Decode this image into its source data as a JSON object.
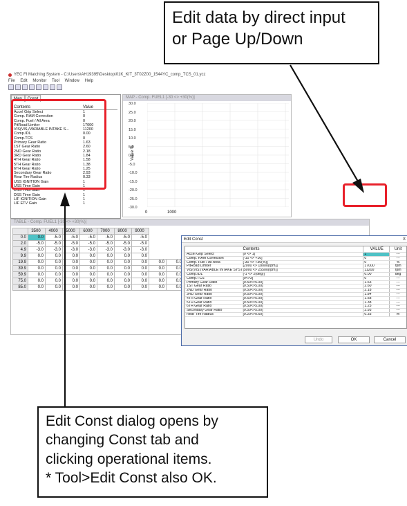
{
  "callouts": {
    "top": "Edit data by direct input\nor Page Up/Down",
    "bottom": "Edit Const dialog opens by\nchanging Const tab and\nclicking operational items.\n* Tool>Edit Const also OK."
  },
  "window": {
    "title": "YEC FI Matching System - C:\\Users\\AH19395\\Desktop\\01K_KIT_3T02Z00_1544YC_comp_TCS_01.ycz",
    "menu": [
      "File",
      "Edit",
      "Monitor",
      "Tool",
      "Window",
      "Help"
    ]
  },
  "left_panel": {
    "tabs": [
      "Map",
      "Const"
    ],
    "columns": [
      "Contents",
      "Value"
    ],
    "rows": [
      [
        "Accel Grip Select",
        "1"
      ],
      [
        "Comp. RAM Correction",
        "0"
      ],
      [
        "Comp. Fuel / All Area",
        "0"
      ],
      [
        "PitRoad Limiter",
        "17000"
      ],
      [
        "VIS(VIS,/VARIABLE INTAKE S...",
        "11200"
      ],
      [
        "Comp.IDL",
        "0.00"
      ],
      [
        "Comp.TCS",
        "0"
      ],
      [
        "Primary Gear Ratio",
        "1.63"
      ],
      [
        "1ST Gear Ratio",
        "2.60"
      ],
      [
        "2ND Gear Ratio",
        "2.18"
      ],
      [
        "3RD Gear Ratio",
        "1.84"
      ],
      [
        "4TH Gear Ratio",
        "1.58"
      ],
      [
        "5TH Gear Ratio",
        "1.38"
      ],
      [
        "6TH Gear Ratio",
        "1.25"
      ],
      [
        "Secondary Gear Ratio",
        "2.93"
      ],
      [
        "Rear Tire Radius",
        "0.33"
      ],
      [
        "USS IGNITION Gain",
        "1"
      ],
      [
        "USS Time Gain",
        "1"
      ],
      [
        "DSS THG Gain",
        "1"
      ],
      [
        "DSS Time Gain",
        "1"
      ],
      [
        "LIF IGNITION Gain",
        "1"
      ],
      [
        "LIF ETV Gain",
        "1"
      ]
    ]
  },
  "graph": {
    "header": "MAP - Comp. FUEL1      [-30 <> +30(%)]",
    "yticks": [
      "30.0",
      "25.0",
      "20.0",
      "15.0",
      "10.0",
      "5.0",
      "0.0",
      "-5.0",
      "-10.0",
      "-15.0",
      "-20.0",
      "-25.0",
      "-30.0"
    ],
    "xticks": [
      "0",
      "1000"
    ],
    "ylabel": "Value %"
  },
  "table": {
    "header": "TABLE - Comp. FUEL1      [-30 <> +30(%)]",
    "columns": [
      "3500",
      "4000",
      "5000",
      "6000",
      "7000",
      "8000",
      "9000"
    ],
    "rows": [
      {
        "h": "0.0",
        "v": [
          "0.0",
          "-5.0",
          "-5.0",
          "-5.0",
          "-5.0",
          "-5.0",
          "-5.0"
        ]
      },
      {
        "h": "2.0",
        "v": [
          "-5.0",
          "-5.0",
          "-5.0",
          "-5.0",
          "-5.0",
          "-5.0",
          "-5.0"
        ]
      },
      {
        "h": "4.9",
        "v": [
          "-3.0",
          "-3.0",
          "-3.0",
          "-3.0",
          "-3.0",
          "-3.0",
          "-3.0"
        ]
      },
      {
        "h": "9.9",
        "v": [
          "0.0",
          "0.0",
          "0.0",
          "0.0",
          "0.0",
          "0.0",
          "0.0"
        ]
      },
      {
        "h": "19.9",
        "v": [
          "0.0",
          "0.0",
          "0.0",
          "0.0",
          "0.0",
          "0.0",
          "0.0",
          "0.0",
          "0.0",
          "0.0",
          "0.0",
          "0.0"
        ]
      },
      {
        "h": "39.9",
        "v": [
          "0.0",
          "0.0",
          "0.0",
          "0.0",
          "0.0",
          "0.0",
          "0.0",
          "0.0",
          "0.0",
          "0.0",
          "0.0",
          "0.0"
        ]
      },
      {
        "h": "59.9",
        "v": [
          "0.0",
          "0.0",
          "0.0",
          "0.0",
          "0.0",
          "0.0",
          "0.0",
          "0.0",
          "0.0",
          "0.0",
          "0.0",
          "0.0"
        ]
      },
      {
        "h": "75.0",
        "v": [
          "0.0",
          "0.0",
          "0.0",
          "0.0",
          "0.0",
          "0.0",
          "0.0",
          "0.0",
          "0.0",
          "0.0",
          "0.0",
          "0.0"
        ]
      },
      {
        "h": "85.0",
        "v": [
          "0.0",
          "0.0",
          "0.0",
          "0.0",
          "0.0",
          "0.0",
          "0.0",
          "0.0",
          "0.0",
          "0.0",
          "0.0",
          "0.0"
        ]
      }
    ]
  },
  "dialog": {
    "title": "Edit Const",
    "close": "X",
    "columns": [
      "Contents",
      "VALUE",
      "Unit"
    ],
    "rows": [
      [
        "Accel Grip Select",
        "[0 <> 1]",
        "1",
        "---"
      ],
      [
        "Comp. RAM Correction",
        "[-10 <> +10]",
        "0",
        "---"
      ],
      [
        "Comp. Fuel / All Area",
        "[-30 <> +30(%)]",
        "0",
        "%"
      ],
      [
        "PitRoad Limiter",
        "[2000 <> 18000(rpm)]",
        "17000",
        "rpm"
      ],
      [
        "VIS(VIS,/VARIABLE INTAKE SYSTEM)",
        "[5000 <> 25500(rpm)]",
        "11200",
        "rpm"
      ],
      [
        "Comp.IDL",
        "[-1 <> 2(deg)]",
        "0.00",
        "deg"
      ],
      [
        "Comp.TCS",
        "[0<>3]",
        "0",
        "---"
      ],
      [
        "Primary Gear Ratio",
        "[0.50<>5.00]",
        "1.63",
        "---"
      ],
      [
        "1ST Gear Ratio",
        "[0.50<>5.00]",
        "2.60",
        "---"
      ],
      [
        "2ND Gear Ratio",
        "[0.50<>5.00]",
        "2.18",
        "---"
      ],
      [
        "3RD Gear Ratio",
        "[0.50<>5.00]",
        "1.84",
        "---"
      ],
      [
        "4TH Gear Ratio",
        "[0.50<>5.00]",
        "1.58",
        "---"
      ],
      [
        "5TH Gear Ratio",
        "[0.50<>5.00]",
        "1.38",
        "---"
      ],
      [
        "6TH Gear Ratio",
        "[0.50<>5.00]",
        "1.25",
        "---"
      ],
      [
        "Secondary Gear Ratio",
        "[0.50<>5.00]",
        "2.93",
        "---"
      ],
      [
        "Rear Tire Radius",
        "[0.20<>0.60]",
        "0.33",
        "m"
      ]
    ],
    "buttons": {
      "undo": "Undo",
      "ok": "OK",
      "cancel": "Cancel"
    }
  },
  "colors": {
    "highlight": "#e8202a",
    "cell_selected": "#4fc2c6"
  }
}
